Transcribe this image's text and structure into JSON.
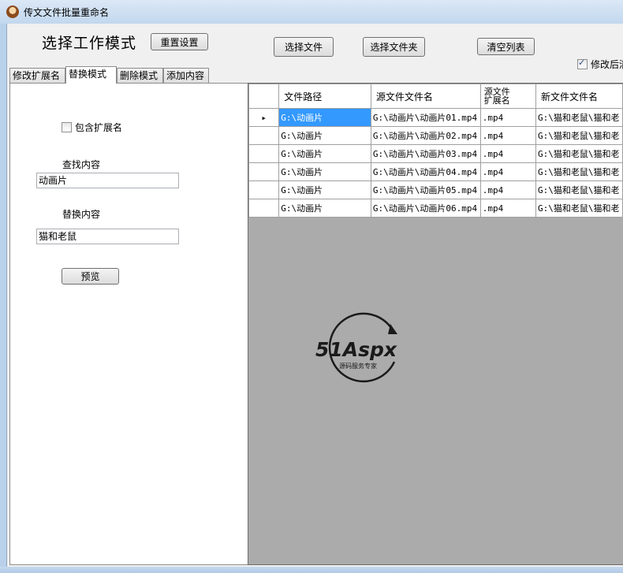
{
  "window": {
    "title": "传文文件批量重命名"
  },
  "toolbar": {
    "mode_label": "选择工作模式",
    "reset_label": "重置设置",
    "select_file_label": "选择文件",
    "select_folder_label": "选择文件夹",
    "clear_list_label": "清空列表",
    "modify_after_label": "修改后清"
  },
  "tabs": [
    {
      "label": "修改扩展名"
    },
    {
      "label": "替换模式",
      "active": true
    },
    {
      "label": "删除模式"
    },
    {
      "label": "添加内容"
    }
  ],
  "panel": {
    "include_ext_label": "包含扩展名",
    "find_label": "查找内容",
    "find_value": "动画片",
    "replace_label": "替换内容",
    "replace_value": "猫和老鼠",
    "preview_label": "预览"
  },
  "grid": {
    "columns": [
      "文件路径",
      "源文件文件名",
      "源文件\n扩展名",
      "新文件文件名"
    ],
    "rows": [
      [
        "G:\\动画片",
        "G:\\动画片\\动画片01.mp4",
        ".mp4",
        "G:\\猫和老鼠\\猫和老"
      ],
      [
        "G:\\动画片",
        "G:\\动画片\\动画片02.mp4",
        ".mp4",
        "G:\\猫和老鼠\\猫和老"
      ],
      [
        "G:\\动画片",
        "G:\\动画片\\动画片03.mp4",
        ".mp4",
        "G:\\猫和老鼠\\猫和老"
      ],
      [
        "G:\\动画片",
        "G:\\动画片\\动画片04.mp4",
        ".mp4",
        "G:\\猫和老鼠\\猫和老"
      ],
      [
        "G:\\动画片",
        "G:\\动画片\\动画片05.mp4",
        ".mp4",
        "G:\\猫和老鼠\\猫和老"
      ],
      [
        "G:\\动画片",
        "G:\\动画片\\动画片06.mp4",
        ".mp4",
        "G:\\猫和老鼠\\猫和老"
      ]
    ]
  },
  "watermark": {
    "brand": "51Aspx",
    "tagline": "源码服务专家"
  },
  "colors": {
    "selection": "#3399ff",
    "grid_bg": "#ababab",
    "logo_red": "#e02020",
    "logo_green": "#2bb34a"
  }
}
